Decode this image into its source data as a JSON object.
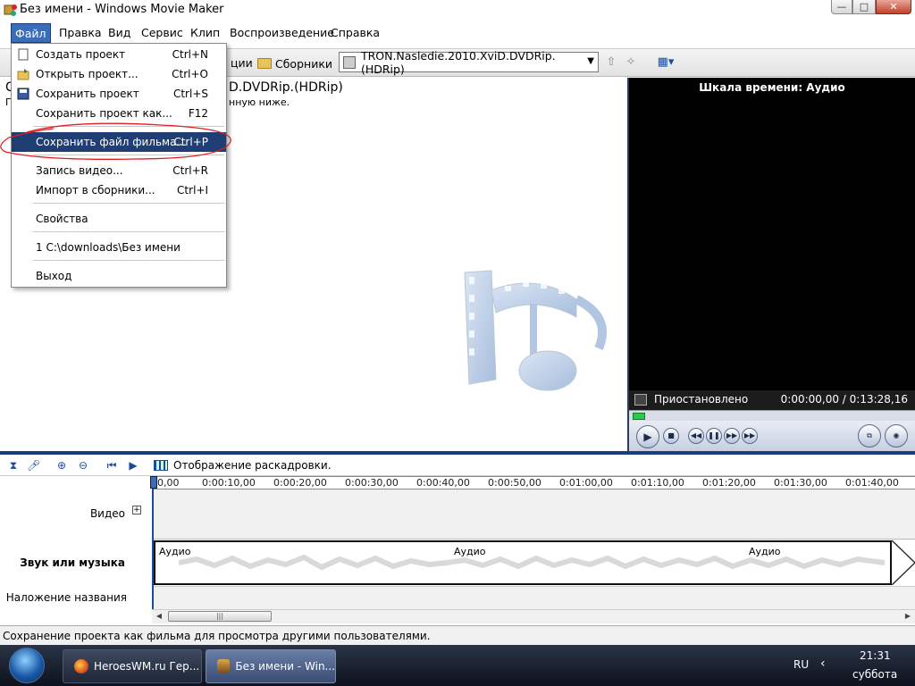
{
  "window": {
    "title": "Без имени - Windows Movie Maker",
    "minimize": "—",
    "maximize": "□",
    "close": "✕"
  },
  "menubar": {
    "items": [
      "Файл",
      "Правка",
      "Вид",
      "Сервис",
      "Клип",
      "Воспроизведение",
      "Справка"
    ]
  },
  "file_menu": {
    "items": [
      {
        "label": "Создать проект",
        "shortcut": "Ctrl+N"
      },
      {
        "label": "Открыть проект...",
        "shortcut": "Ctrl+O"
      },
      {
        "label": "Сохранить проект",
        "shortcut": "Ctrl+S"
      },
      {
        "label": "Сохранить проект как...",
        "shortcut": "F12"
      },
      {
        "label": "Сохранить файл фильма...",
        "shortcut": "Ctrl+P"
      },
      {
        "label": "Запись видео...",
        "shortcut": "Ctrl+R"
      },
      {
        "label": "Импорт в сборники...",
        "shortcut": "Ctrl+I"
      },
      {
        "label": "Свойства",
        "shortcut": ""
      },
      {
        "label": "1 C:\\downloads\\Без имени",
        "shortcut": ""
      },
      {
        "label": "Выход",
        "shortcut": ""
      }
    ]
  },
  "toolbar": {
    "partial_label": "ции",
    "collections_label": "Сборники",
    "collection_selected": "TRON.Nasledie.2010.XviD.DVDRip.(HDRip)"
  },
  "collection": {
    "title_start": "С",
    "title_end": "D.DVDRip.(HDRip)",
    "subtitle_start": "П",
    "subtitle_end": "нную ниже."
  },
  "preview": {
    "header": "Шкала времени: Аудио",
    "status": "Приостановлено",
    "time": "0:00:00,00 / 0:13:28,16",
    "seek_progress": 0.0
  },
  "timeline": {
    "storyboard_label": "Отображение раскадровки.",
    "ruler_ticks": [
      "0,00",
      "0:00:10,00",
      "0:00:20,00",
      "0:00:30,00",
      "0:00:40,00",
      "0:00:50,00",
      "0:01:00,00",
      "0:01:10,00",
      "0:01:20,00",
      "0:01:30,00",
      "0:01:40,00"
    ],
    "tracks": {
      "video": "Видео",
      "audio": "Звук или музыка",
      "title_overlay": "Наложение названия"
    },
    "expand_symbol": "+",
    "audio_clip_labels": [
      "Аудио",
      "Аудио",
      "Аудио"
    ]
  },
  "statusbar": {
    "text": "Сохранение проекта как фильма для просмотра другими пользователями."
  },
  "taskbar": {
    "tasks": [
      "HeroesWM.ru Гер...",
      "Без имени - Win..."
    ],
    "lang": "RU",
    "time": "21:31",
    "day": "суббота"
  },
  "icons": {
    "app": "movie-maker-icon",
    "folder": "folder-icon",
    "play": "▶",
    "stop": "■",
    "prev": "◀◀",
    "pause_frame": "❚❚",
    "next": "▶▶"
  },
  "colors": {
    "menu_highlight": "#1f3f74",
    "splitter": "#1a3d7c",
    "accent": "#3b6cb7",
    "annotation": "#e02020"
  }
}
